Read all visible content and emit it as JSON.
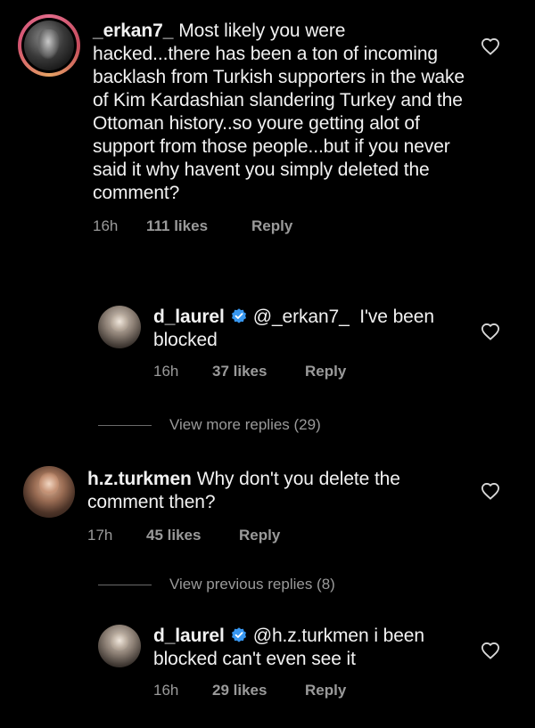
{
  "comments": [
    {
      "username": "_erkan7_",
      "text": "Most likely you were hacked...there has been a ton of incoming backlash from Turkish supporters in the wake of Kim Kardashian slandering Turkey and the Ottoman history..so youre getting alot of support from those people...but if you never said it why havent you simply deleted the comment?",
      "time": "16h",
      "likes": "111 likes",
      "reply": "Reply"
    },
    {
      "username": "d_laurel",
      "verified": true,
      "mention": "@_erkan7_",
      "text": "I've been blocked",
      "time": "16h",
      "likes": "37 likes",
      "reply": "Reply"
    },
    {
      "username": "h.z.turkmen",
      "text": "Why don't you delete the comment then?",
      "time": "17h",
      "likes": "45 likes",
      "reply": "Reply"
    },
    {
      "username": "d_laurel",
      "verified": true,
      "mention": "@h.z.turkmen",
      "text": "i been blocked can't even see it",
      "time": "16h",
      "likes": "29 likes",
      "reply": "Reply"
    }
  ],
  "view_more_replies": "View more replies (29)",
  "view_previous_replies": "View previous replies (8)",
  "icons": {
    "like": "heart-outline-icon",
    "verified": "verified-badge-icon"
  },
  "colors": {
    "background": "#000000",
    "text": "#f2f2f2",
    "secondary": "#9a9a9a",
    "verified": "#3897f0"
  }
}
